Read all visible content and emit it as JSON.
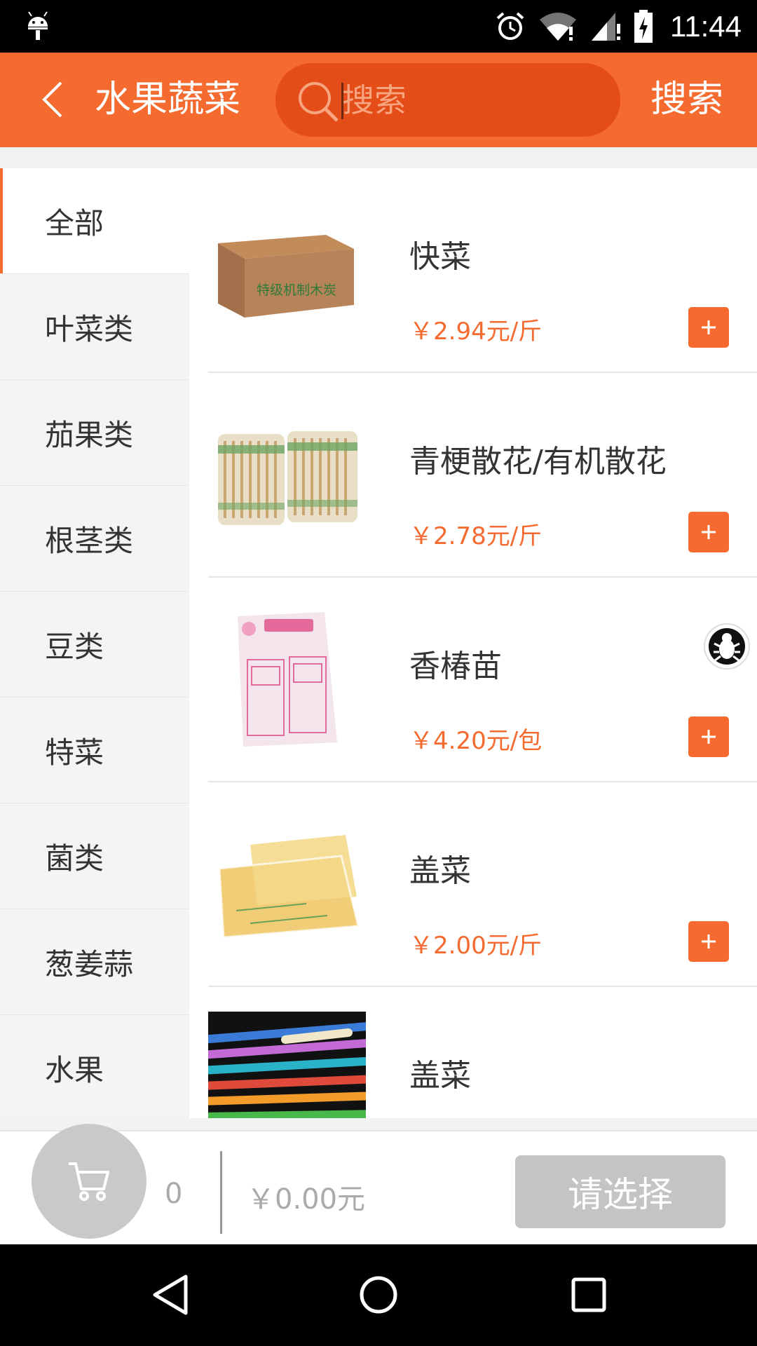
{
  "status_bar": {
    "time": "11:44"
  },
  "header": {
    "title": "水果蔬菜",
    "search_placeholder": "搜索",
    "search_button": "搜索"
  },
  "sidebar": {
    "items": [
      {
        "label": "全部",
        "active": true
      },
      {
        "label": "叶菜类"
      },
      {
        "label": "茄果类"
      },
      {
        "label": "根茎类"
      },
      {
        "label": "豆类"
      },
      {
        "label": "特菜"
      },
      {
        "label": "菌类"
      },
      {
        "label": "葱姜蒜"
      },
      {
        "label": "水果"
      }
    ]
  },
  "products": [
    {
      "name": "快菜",
      "price": "￥2.94元/斤",
      "image": "box-image"
    },
    {
      "name": "青梗散花/有机散花",
      "price": "￥2.78元/斤",
      "image": "chopsticks-image"
    },
    {
      "name": "香椿苗",
      "price": "￥4.20元/包",
      "image": "bag-image"
    },
    {
      "name": "盖菜",
      "price": "￥2.00元/斤",
      "image": "towel-image"
    },
    {
      "name": "盖菜",
      "price": "",
      "image": "straws-image"
    }
  ],
  "cart": {
    "count": "0",
    "total": "￥0.00元",
    "checkout_label": "请选择"
  },
  "colors": {
    "accent": "#f56a2f",
    "search_bg": "#e44c18"
  }
}
